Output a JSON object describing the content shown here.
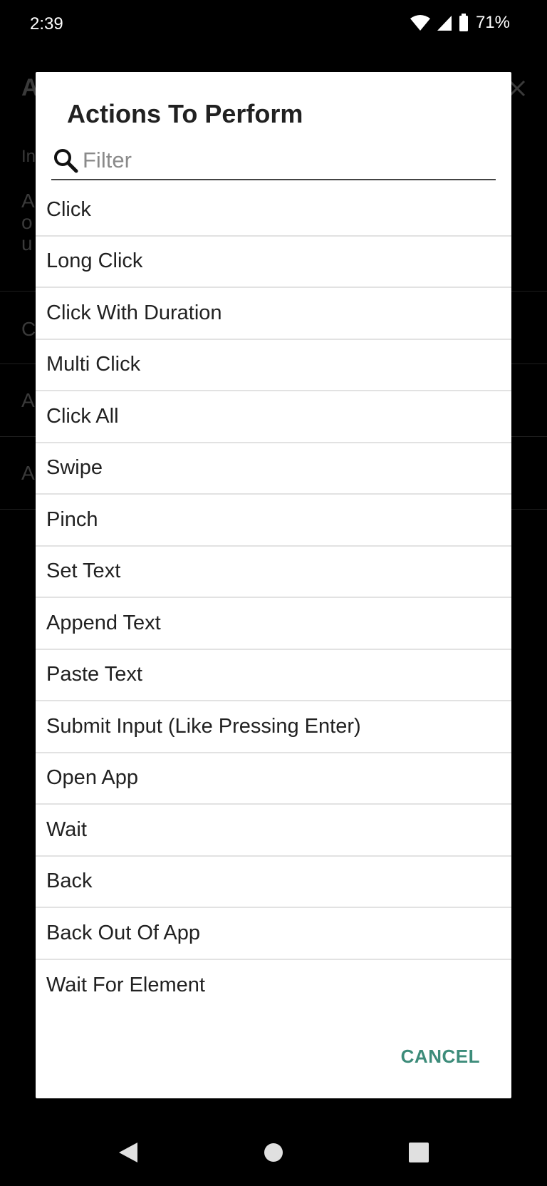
{
  "status_bar": {
    "time": "2:39",
    "battery": "71%"
  },
  "background": {
    "letters": [
      "A",
      "In",
      "A",
      "o",
      "u",
      "C",
      "A",
      "A"
    ]
  },
  "dialog": {
    "title": "Actions To Perform",
    "filter": {
      "placeholder": "Filter",
      "value": ""
    },
    "actions": [
      "Click",
      "Long Click",
      "Click With Duration",
      "Multi Click",
      "Click All",
      "Swipe",
      "Pinch",
      "Set Text",
      "Append Text",
      "Paste Text",
      "Submit Input (Like Pressing Enter)",
      "Open App",
      "Wait",
      "Back",
      "Back Out Of App",
      "Wait For Element"
    ],
    "cancel_label": "CANCEL"
  },
  "colors": {
    "accent": "#3d8c7a",
    "scrim": "#000000",
    "dialog": "#ffffff"
  }
}
